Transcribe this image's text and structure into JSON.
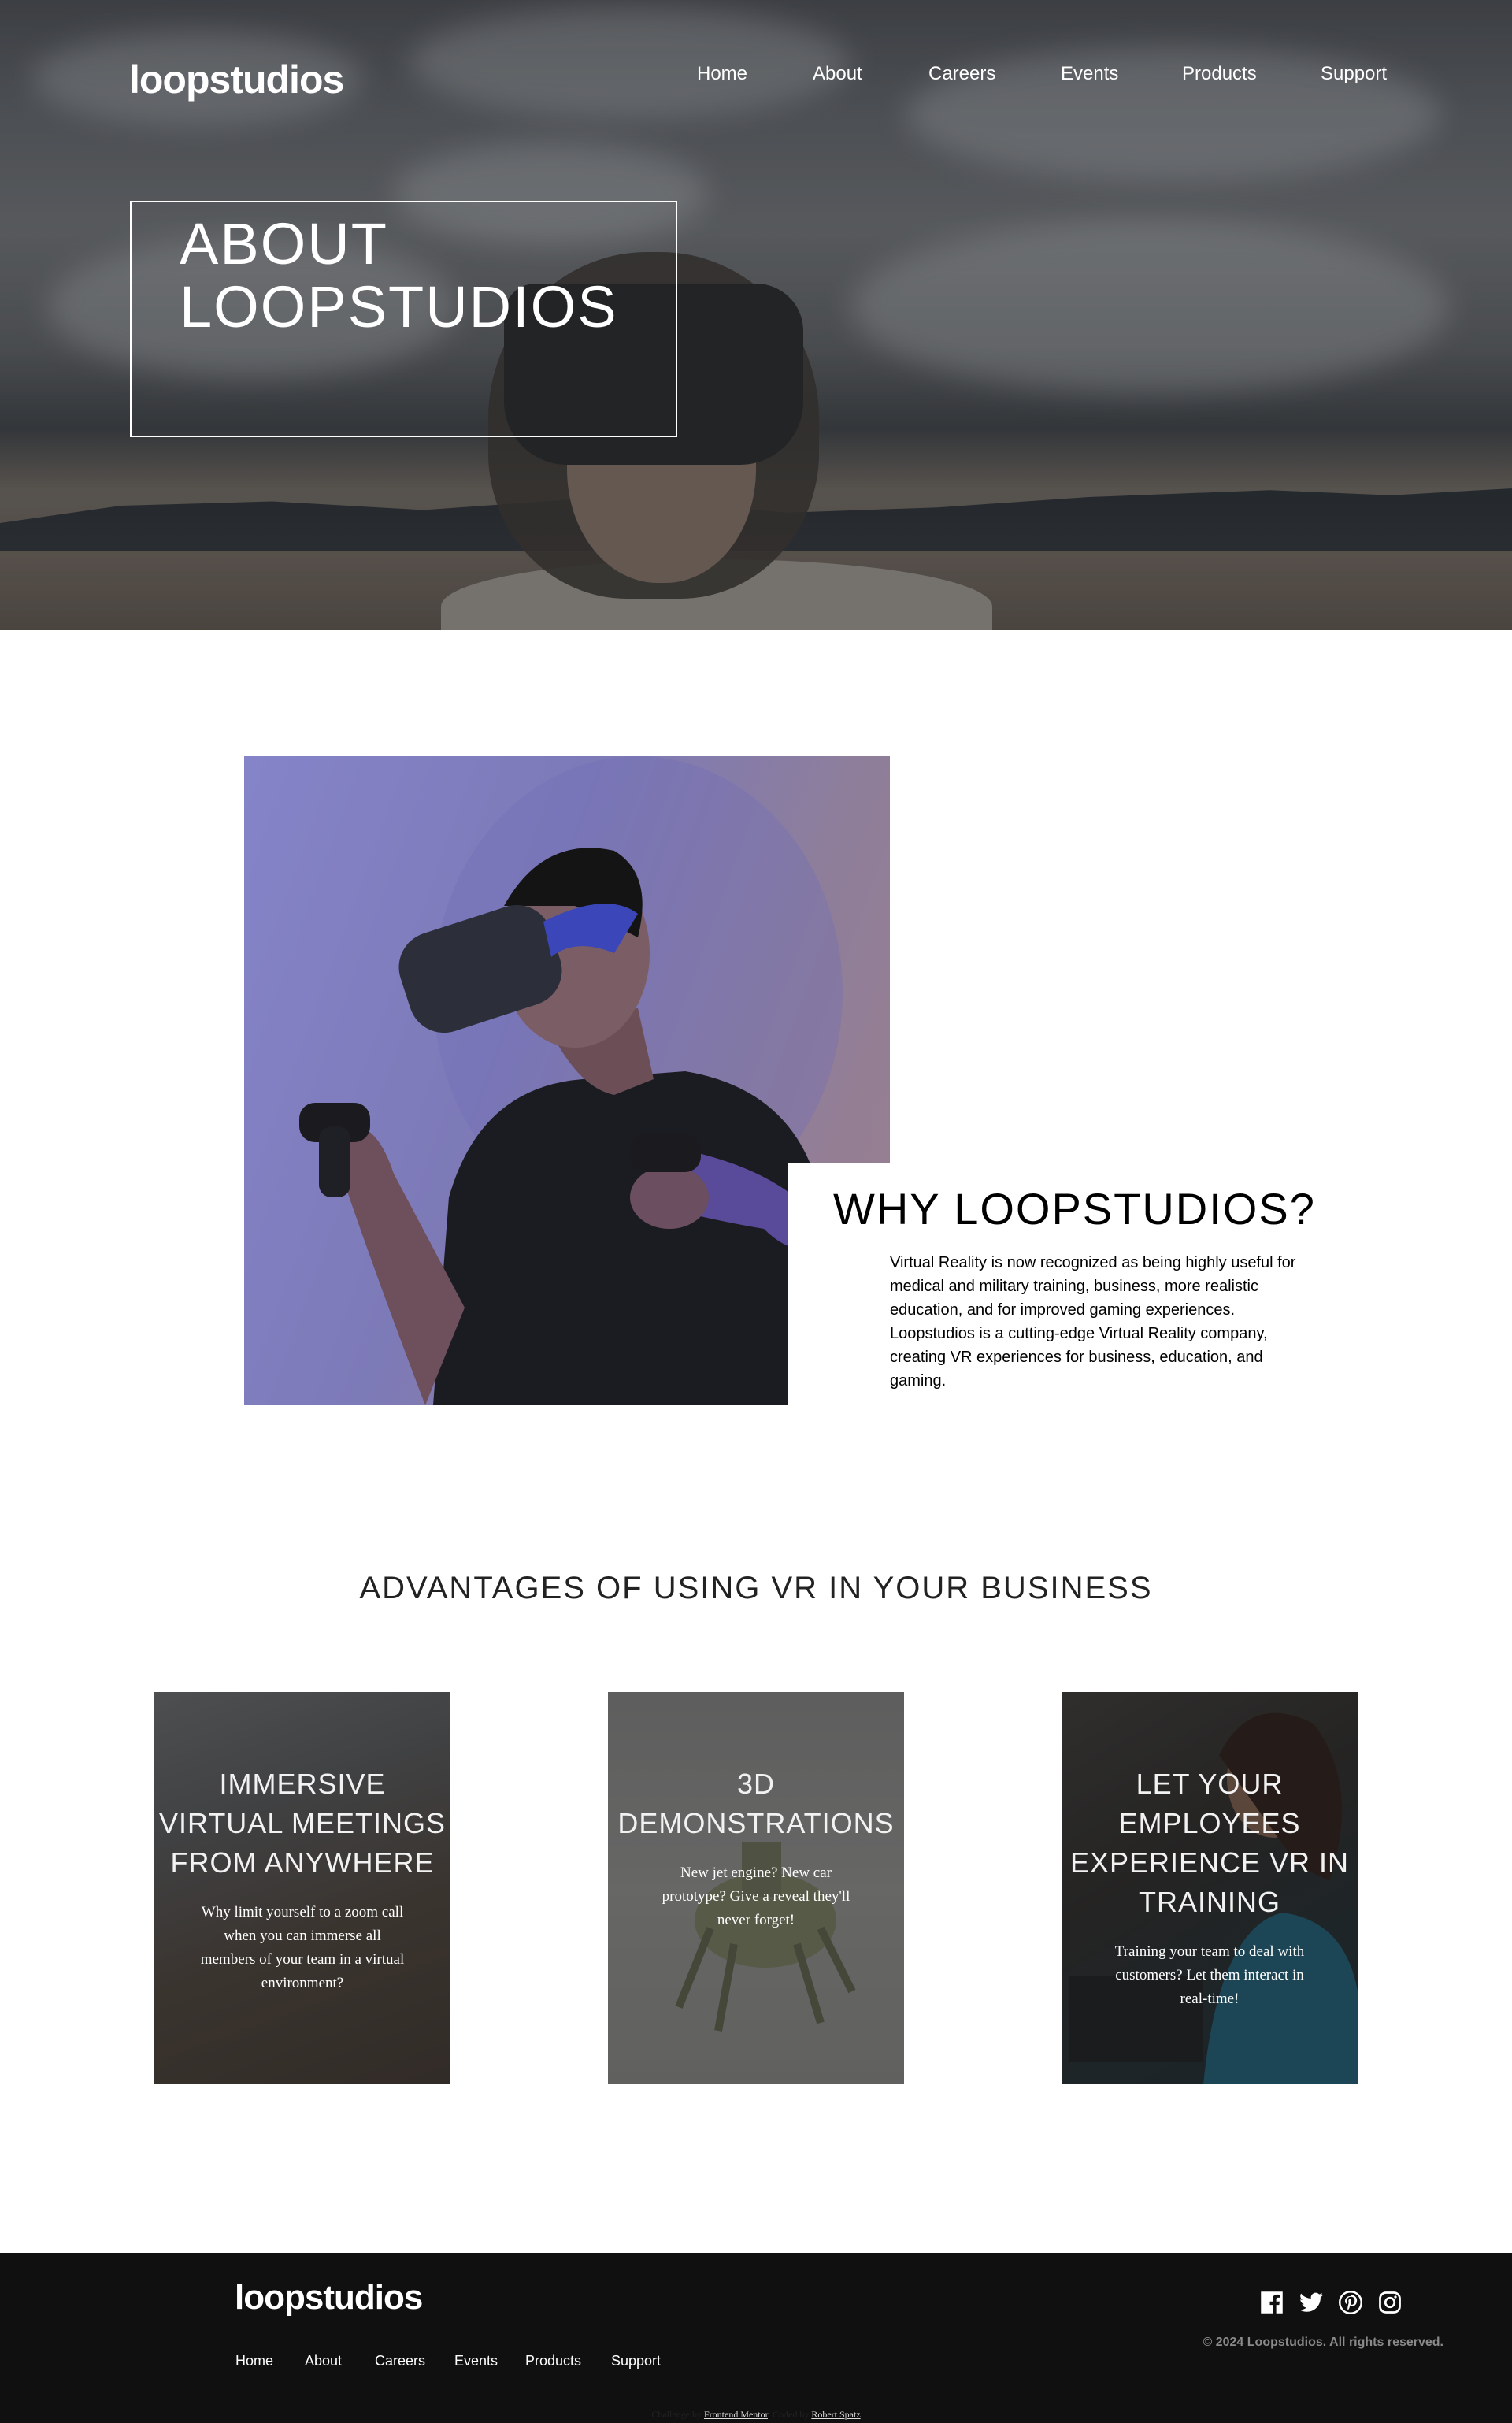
{
  "header": {
    "logo": "loopstudios",
    "nav": [
      "Home",
      "About",
      "Careers",
      "Events",
      "Products",
      "Support"
    ]
  },
  "hero": {
    "title_line1": "ABOUT",
    "title_line2": "LOOPSTUDIOS"
  },
  "why": {
    "title": "WHY LOOPSTUDIOS?",
    "text": "Virtual Reality is now recognized as being highly useful for medical and military training, business, more realistic education, and for improved gaming experiences. Loopstudios is a cutting-edge Virtual Reality company, creating VR experiences for business, education, and gaming."
  },
  "advantages": {
    "title": "ADVANTAGES OF USING VR IN YOUR BUSINESS",
    "cards": [
      {
        "title": "IMMERSIVE VIRTUAL MEETINGS FROM ANYWHERE",
        "text": "Why limit yourself to a zoom call when you can immerse all members of your team in a virtual environment?"
      },
      {
        "title": "3D DEMONSTRATIONS",
        "text": "New jet engine? New car prototype? Give a reveal they'll never forget!"
      },
      {
        "title": "LET YOUR EMPLOYEES EXPERIENCE VR IN TRAINING",
        "text": "Training your team to deal with customers? Let them interact in real-time!"
      }
    ]
  },
  "footer": {
    "logo": "loopstudios",
    "nav": [
      "Home",
      "About",
      "Careers",
      "Events",
      "Products",
      "Support"
    ],
    "social_icons": [
      "facebook-icon",
      "twitter-icon",
      "pinterest-icon",
      "instagram-icon"
    ],
    "copyright": "© 2024 Loopstudios. All rights reserved.",
    "attribution_prefix": "Challenge by",
    "attribution_challenge": "Frontend Mentor",
    "attribution_middle": ". Coded by",
    "attribution_author": "Robert Spatz"
  }
}
